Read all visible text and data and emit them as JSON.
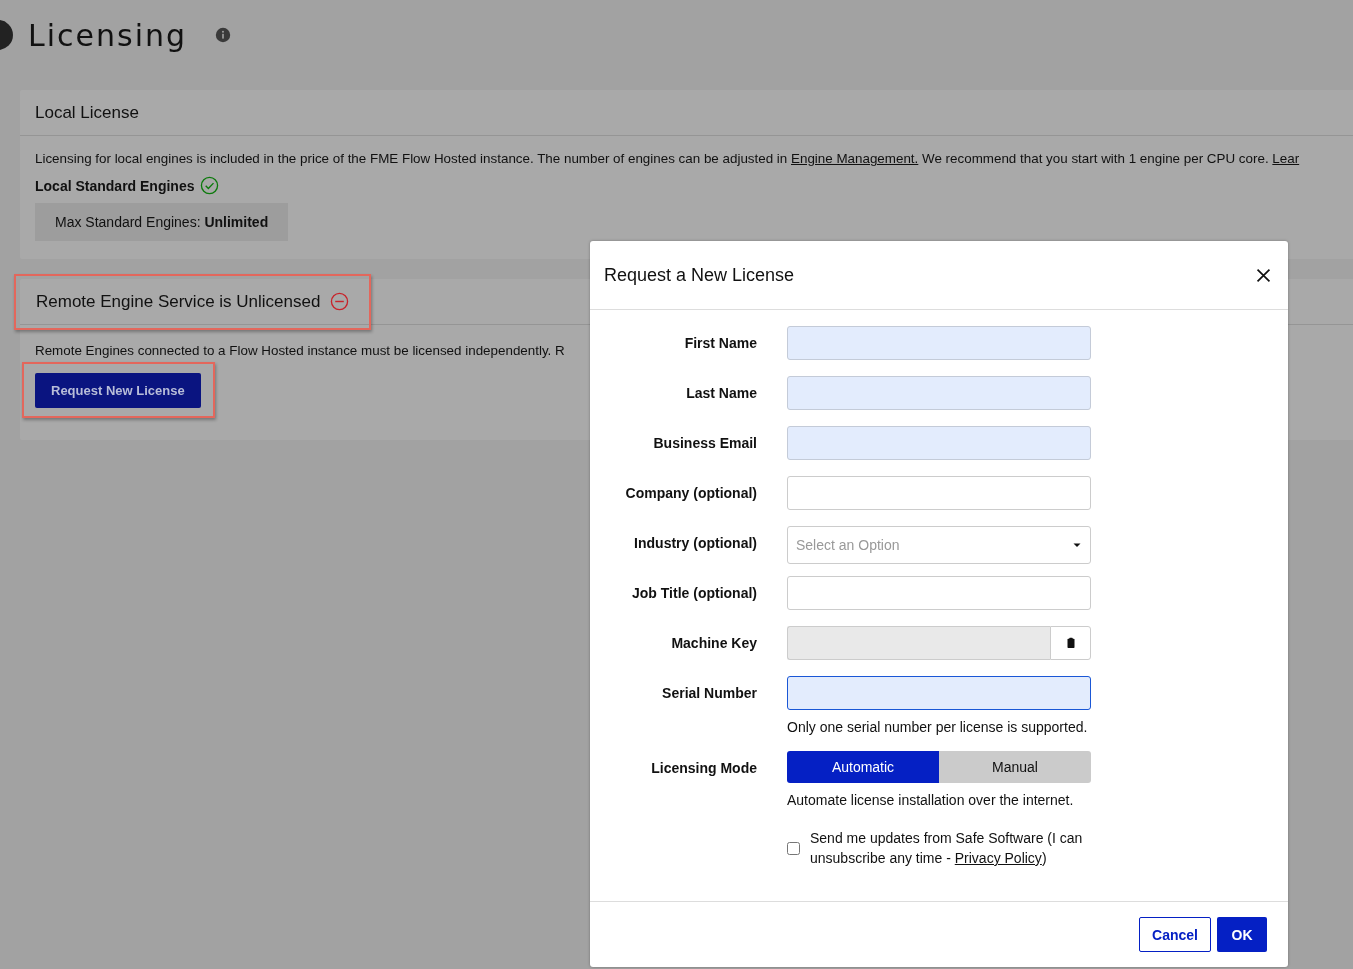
{
  "page": {
    "title": "Licensing"
  },
  "local_license": {
    "title": "Local License",
    "description": [
      {
        "kind": "text",
        "text": "Licensing for local engines is included in the price of the FME Flow Hosted instance. The number of engines can be adjusted in "
      },
      {
        "kind": "link",
        "text": "Engine Management."
      },
      {
        "kind": "text",
        "text": " We recommend that you start with 1 engine per CPU core. "
      },
      {
        "kind": "link",
        "text": "Lear"
      }
    ],
    "engines_label": "Local Standard Engines",
    "engines_ok": true,
    "max_engines": "Max Standard Engines: **Unlimited**"
  },
  "remote_license": {
    "title": "Remote Engine Service is Unlicensed",
    "licensed": false,
    "highlighted": true,
    "description": "Remote Engines connected to a Flow Hosted instance must be licensed independently. R",
    "button": {
      "label": "Request New License",
      "highlighted": true
    }
  },
  "dialog": {
    "title": "Request a New License",
    "fields": [
      {
        "kind": "text",
        "label": "First Name",
        "autofilled": true,
        "focused": false
      },
      {
        "kind": "text",
        "label": "Last Name",
        "autofilled": true,
        "focused": false
      },
      {
        "kind": "text",
        "label": "Business Email",
        "autofilled": true,
        "focused": false
      },
      {
        "kind": "text",
        "label": "Company (optional)",
        "autofilled": false,
        "focused": false
      },
      {
        "kind": "select",
        "label": "Industry (optional)",
        "placeholder": "Select an Option"
      },
      {
        "kind": "text",
        "label": "Job Title (optional)",
        "autofilled": false,
        "focused": false
      },
      {
        "kind": "key",
        "label": "Machine Key"
      },
      {
        "kind": "text",
        "label": "Serial Number",
        "autofilled": true,
        "focused": true,
        "hint": "Only one serial number per license is supported."
      }
    ],
    "mode": {
      "label": "Licensing Mode",
      "options": [
        {
          "label": "Automatic",
          "selected": true
        },
        {
          "label": "Manual",
          "selected": false
        }
      ],
      "hint": "Automate license installation over the internet."
    },
    "updates": {
      "checked": false,
      "text": "Send me updates from Safe Software (I can unsubscribe any time - ",
      "link": "Privacy Policy",
      "after": ")"
    },
    "buttons": [
      {
        "kind": "secondary",
        "label": "Cancel"
      },
      {
        "kind": "primary",
        "label": "OK"
      }
    ]
  }
}
